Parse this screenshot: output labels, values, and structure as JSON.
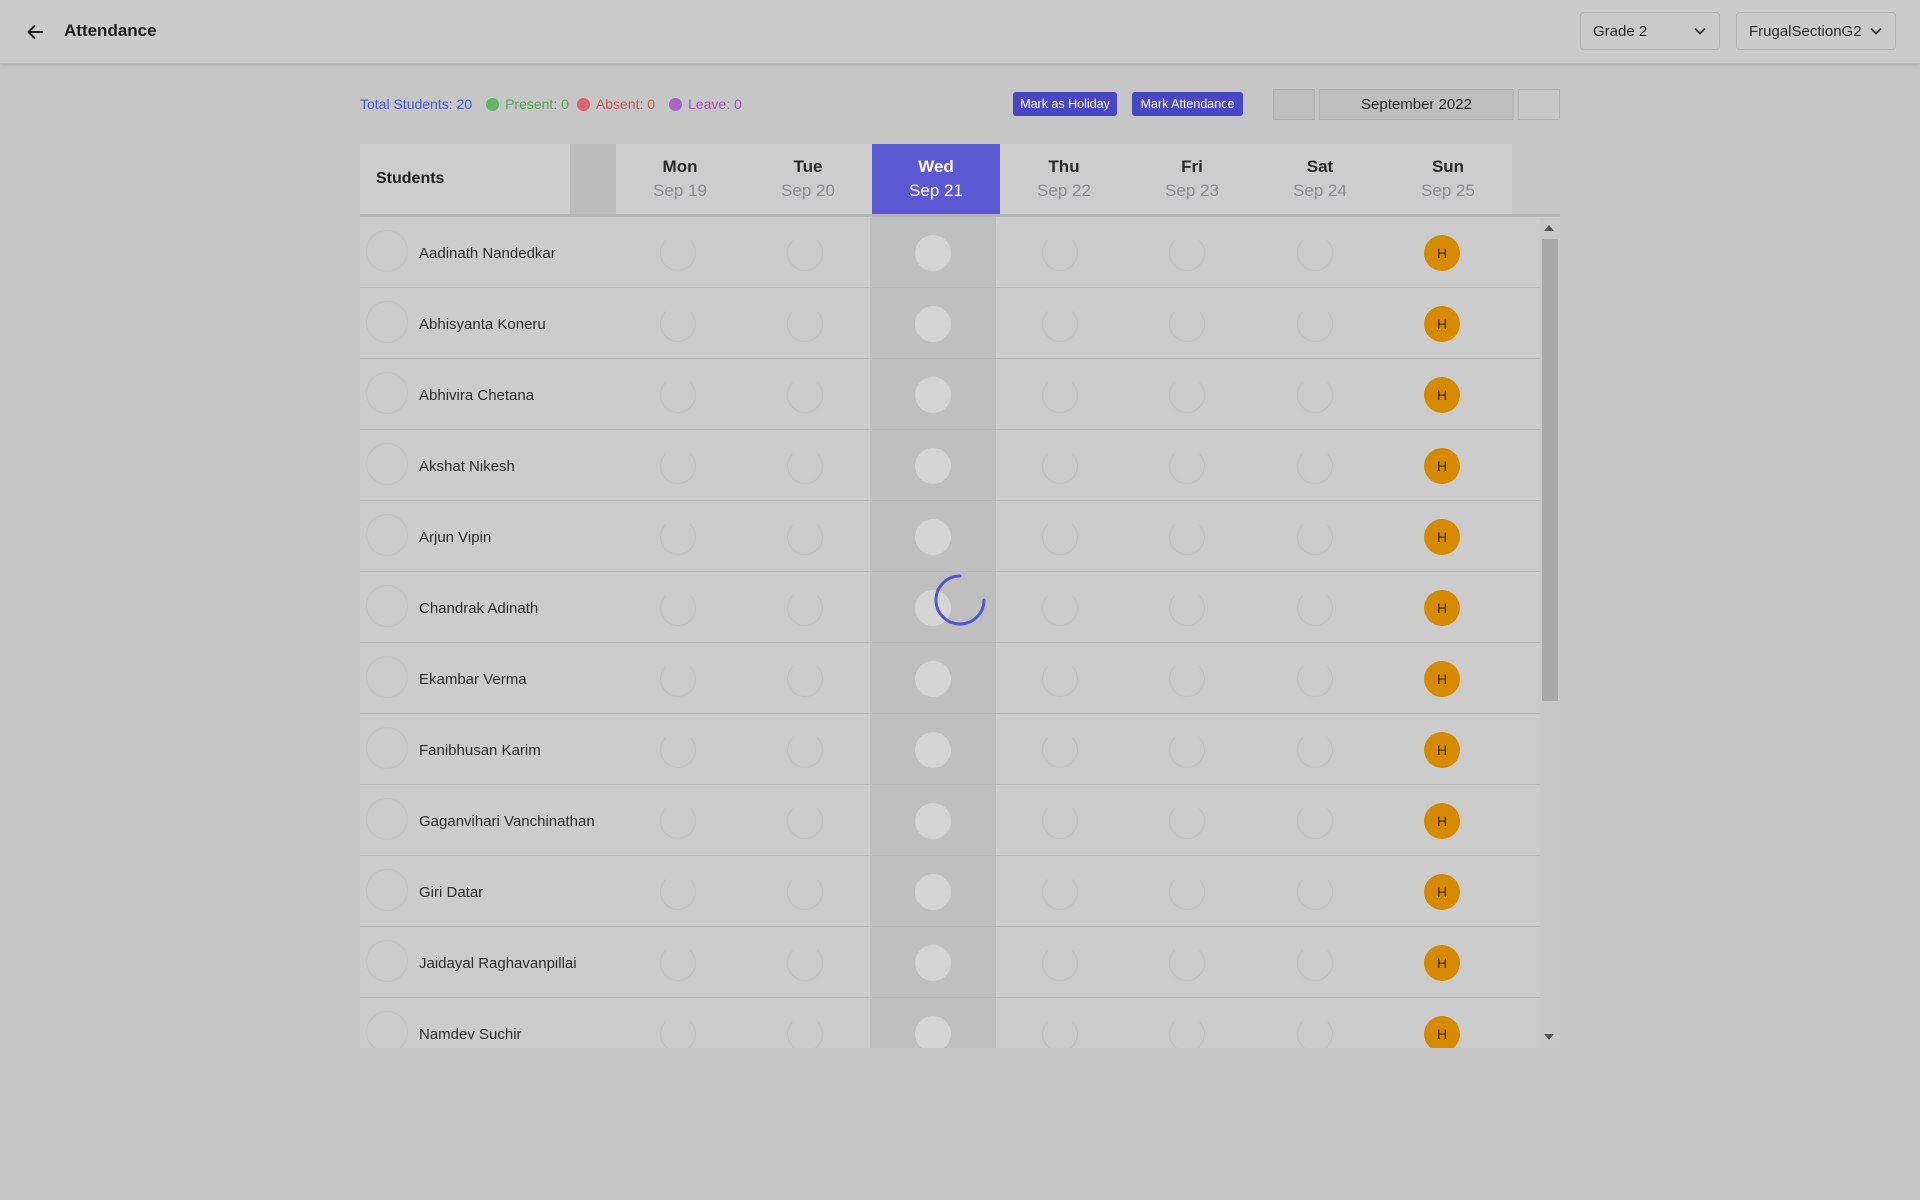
{
  "header": {
    "title": "Attendance",
    "grade_select": "Grade 2",
    "section_select": "FrugalSectionG2"
  },
  "stats": {
    "total": "Total Students: 20",
    "present": "Present: 0",
    "absent": "Absent: 0",
    "leave": "Leave: 0",
    "colors": {
      "total": "#4b56c8",
      "present": "#58a35c",
      "absent": "#c5595e",
      "leave": "#9a57b6"
    }
  },
  "actions": {
    "mark_holiday": "Mark as Holiday",
    "mark_attendance": "Mark Attendance"
  },
  "calendar": {
    "month": "September 2022"
  },
  "table": {
    "students_header": "Students",
    "days": [
      {
        "name": "Mon",
        "date": "Sep 19"
      },
      {
        "name": "Tue",
        "date": "Sep 20"
      },
      {
        "name": "Wed",
        "date": "Sep 21",
        "active": true
      },
      {
        "name": "Thu",
        "date": "Sep 22"
      },
      {
        "name": "Fri",
        "date": "Sep 23"
      },
      {
        "name": "Sat",
        "date": "Sep 24"
      },
      {
        "name": "Sun",
        "date": "Sep 25",
        "holiday": true
      }
    ],
    "holiday_label": "H",
    "students": [
      "Aadinath Nandedkar",
      "Abhisyanta Koneru",
      "Abhivira Chetana",
      "Akshat Nikesh",
      "Arjun Vipin",
      "Chandrak Adinath",
      "Ekambar Verma",
      "Fanibhusan Karim",
      "Gaganvihari Vanchinathan",
      "Giri Datar",
      "Jaidayal Raghavanpillai",
      "Namdev Suchir"
    ]
  },
  "theme": {
    "accent": "#5b58d1",
    "button": "#4a47c7",
    "holiday": "#d58a00"
  },
  "icons": {
    "back": "arrow-left-icon",
    "dropdown": "chevron-down-icon",
    "loading": "spinner-icon"
  }
}
